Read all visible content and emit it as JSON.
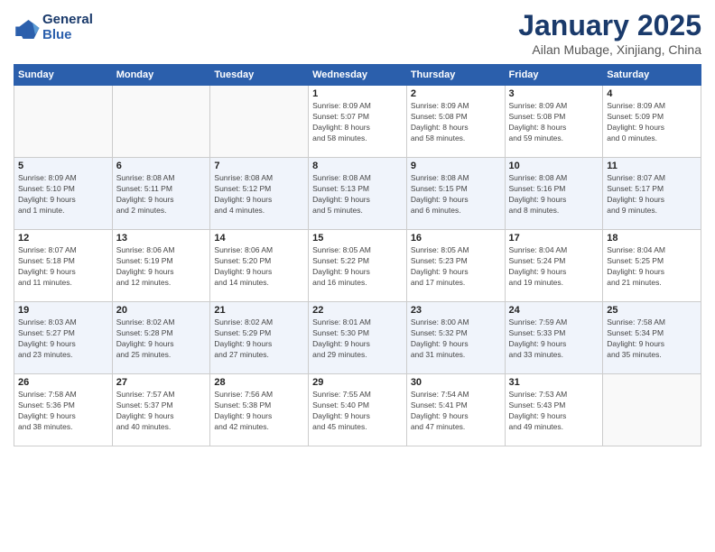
{
  "logo": {
    "line1": "General",
    "line2": "Blue"
  },
  "title": "January 2025",
  "subtitle": "Ailan Mubage, Xinjiang, China",
  "days_of_week": [
    "Sunday",
    "Monday",
    "Tuesday",
    "Wednesday",
    "Thursday",
    "Friday",
    "Saturday"
  ],
  "weeks": [
    [
      {
        "day": "",
        "info": ""
      },
      {
        "day": "",
        "info": ""
      },
      {
        "day": "",
        "info": ""
      },
      {
        "day": "1",
        "info": "Sunrise: 8:09 AM\nSunset: 5:07 PM\nDaylight: 8 hours\nand 58 minutes."
      },
      {
        "day": "2",
        "info": "Sunrise: 8:09 AM\nSunset: 5:08 PM\nDaylight: 8 hours\nand 58 minutes."
      },
      {
        "day": "3",
        "info": "Sunrise: 8:09 AM\nSunset: 5:08 PM\nDaylight: 8 hours\nand 59 minutes."
      },
      {
        "day": "4",
        "info": "Sunrise: 8:09 AM\nSunset: 5:09 PM\nDaylight: 9 hours\nand 0 minutes."
      }
    ],
    [
      {
        "day": "5",
        "info": "Sunrise: 8:09 AM\nSunset: 5:10 PM\nDaylight: 9 hours\nand 1 minute."
      },
      {
        "day": "6",
        "info": "Sunrise: 8:08 AM\nSunset: 5:11 PM\nDaylight: 9 hours\nand 2 minutes."
      },
      {
        "day": "7",
        "info": "Sunrise: 8:08 AM\nSunset: 5:12 PM\nDaylight: 9 hours\nand 4 minutes."
      },
      {
        "day": "8",
        "info": "Sunrise: 8:08 AM\nSunset: 5:13 PM\nDaylight: 9 hours\nand 5 minutes."
      },
      {
        "day": "9",
        "info": "Sunrise: 8:08 AM\nSunset: 5:15 PM\nDaylight: 9 hours\nand 6 minutes."
      },
      {
        "day": "10",
        "info": "Sunrise: 8:08 AM\nSunset: 5:16 PM\nDaylight: 9 hours\nand 8 minutes."
      },
      {
        "day": "11",
        "info": "Sunrise: 8:07 AM\nSunset: 5:17 PM\nDaylight: 9 hours\nand 9 minutes."
      }
    ],
    [
      {
        "day": "12",
        "info": "Sunrise: 8:07 AM\nSunset: 5:18 PM\nDaylight: 9 hours\nand 11 minutes."
      },
      {
        "day": "13",
        "info": "Sunrise: 8:06 AM\nSunset: 5:19 PM\nDaylight: 9 hours\nand 12 minutes."
      },
      {
        "day": "14",
        "info": "Sunrise: 8:06 AM\nSunset: 5:20 PM\nDaylight: 9 hours\nand 14 minutes."
      },
      {
        "day": "15",
        "info": "Sunrise: 8:05 AM\nSunset: 5:22 PM\nDaylight: 9 hours\nand 16 minutes."
      },
      {
        "day": "16",
        "info": "Sunrise: 8:05 AM\nSunset: 5:23 PM\nDaylight: 9 hours\nand 17 minutes."
      },
      {
        "day": "17",
        "info": "Sunrise: 8:04 AM\nSunset: 5:24 PM\nDaylight: 9 hours\nand 19 minutes."
      },
      {
        "day": "18",
        "info": "Sunrise: 8:04 AM\nSunset: 5:25 PM\nDaylight: 9 hours\nand 21 minutes."
      }
    ],
    [
      {
        "day": "19",
        "info": "Sunrise: 8:03 AM\nSunset: 5:27 PM\nDaylight: 9 hours\nand 23 minutes."
      },
      {
        "day": "20",
        "info": "Sunrise: 8:02 AM\nSunset: 5:28 PM\nDaylight: 9 hours\nand 25 minutes."
      },
      {
        "day": "21",
        "info": "Sunrise: 8:02 AM\nSunset: 5:29 PM\nDaylight: 9 hours\nand 27 minutes."
      },
      {
        "day": "22",
        "info": "Sunrise: 8:01 AM\nSunset: 5:30 PM\nDaylight: 9 hours\nand 29 minutes."
      },
      {
        "day": "23",
        "info": "Sunrise: 8:00 AM\nSunset: 5:32 PM\nDaylight: 9 hours\nand 31 minutes."
      },
      {
        "day": "24",
        "info": "Sunrise: 7:59 AM\nSunset: 5:33 PM\nDaylight: 9 hours\nand 33 minutes."
      },
      {
        "day": "25",
        "info": "Sunrise: 7:58 AM\nSunset: 5:34 PM\nDaylight: 9 hours\nand 35 minutes."
      }
    ],
    [
      {
        "day": "26",
        "info": "Sunrise: 7:58 AM\nSunset: 5:36 PM\nDaylight: 9 hours\nand 38 minutes."
      },
      {
        "day": "27",
        "info": "Sunrise: 7:57 AM\nSunset: 5:37 PM\nDaylight: 9 hours\nand 40 minutes."
      },
      {
        "day": "28",
        "info": "Sunrise: 7:56 AM\nSunset: 5:38 PM\nDaylight: 9 hours\nand 42 minutes."
      },
      {
        "day": "29",
        "info": "Sunrise: 7:55 AM\nSunset: 5:40 PM\nDaylight: 9 hours\nand 45 minutes."
      },
      {
        "day": "30",
        "info": "Sunrise: 7:54 AM\nSunset: 5:41 PM\nDaylight: 9 hours\nand 47 minutes."
      },
      {
        "day": "31",
        "info": "Sunrise: 7:53 AM\nSunset: 5:43 PM\nDaylight: 9 hours\nand 49 minutes."
      },
      {
        "day": "",
        "info": ""
      }
    ]
  ]
}
